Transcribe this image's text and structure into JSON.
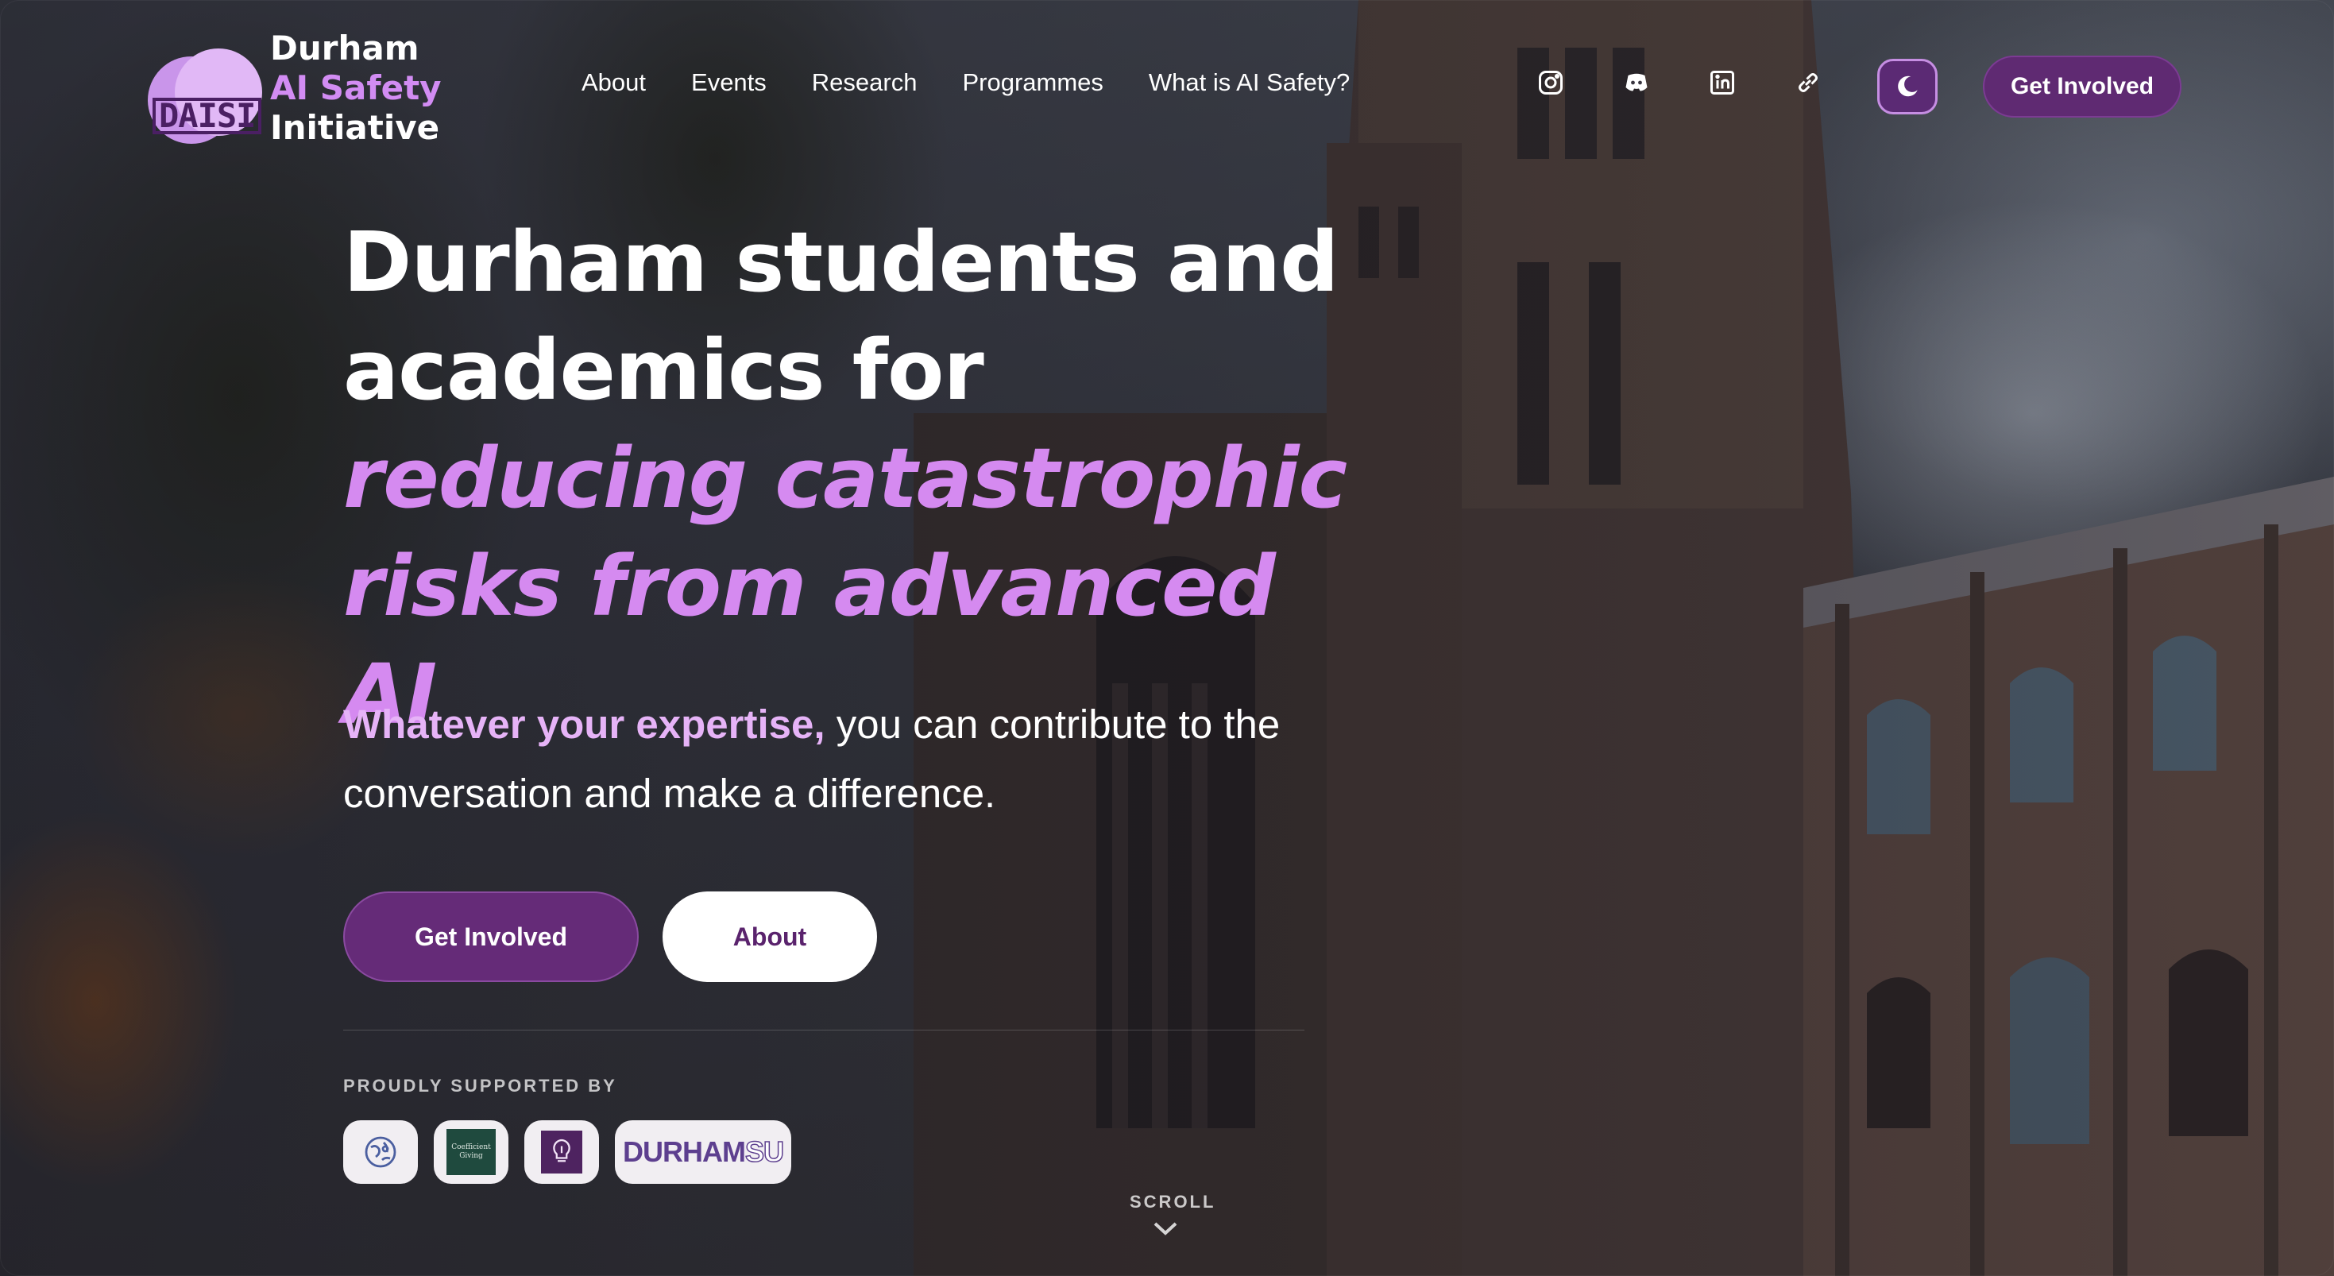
{
  "header": {
    "logo": {
      "mark_text": "DAISI",
      "line1": "Durham",
      "line2": "AI Safety",
      "line3": "Initiative"
    },
    "nav": [
      {
        "label": "About"
      },
      {
        "label": "Events"
      },
      {
        "label": "Research"
      },
      {
        "label": "Programmes"
      },
      {
        "label": "What is AI Safety?"
      }
    ],
    "social_icons": [
      "instagram-icon",
      "discord-icon",
      "linkedin-icon",
      "link-icon"
    ],
    "theme_toggle_icon": "moon-icon",
    "cta_label": "Get Involved"
  },
  "hero": {
    "headline_part1": "Durham students and academics for ",
    "headline_accent": "reducing catastrophic risks from advanced AI",
    "subhead_accent": "Whatever your expertise,",
    "subhead_rest": " you can contribute to the conversation and make a difference.",
    "primary_button": "Get Involved",
    "secondary_button": "About"
  },
  "supported": {
    "label": "PROUDLY SUPPORTED BY",
    "sponsors": [
      {
        "name": "globe-logo"
      },
      {
        "name": "Coefficient Giving"
      },
      {
        "name": "lightbulb-logo"
      },
      {
        "name": "DURHAM",
        "suffix": "SU"
      }
    ]
  },
  "scroll_label": "SCROLL",
  "colors": {
    "accent": "#d58af0",
    "button_purple": "#652b78",
    "header_button": "#5f2a72"
  }
}
